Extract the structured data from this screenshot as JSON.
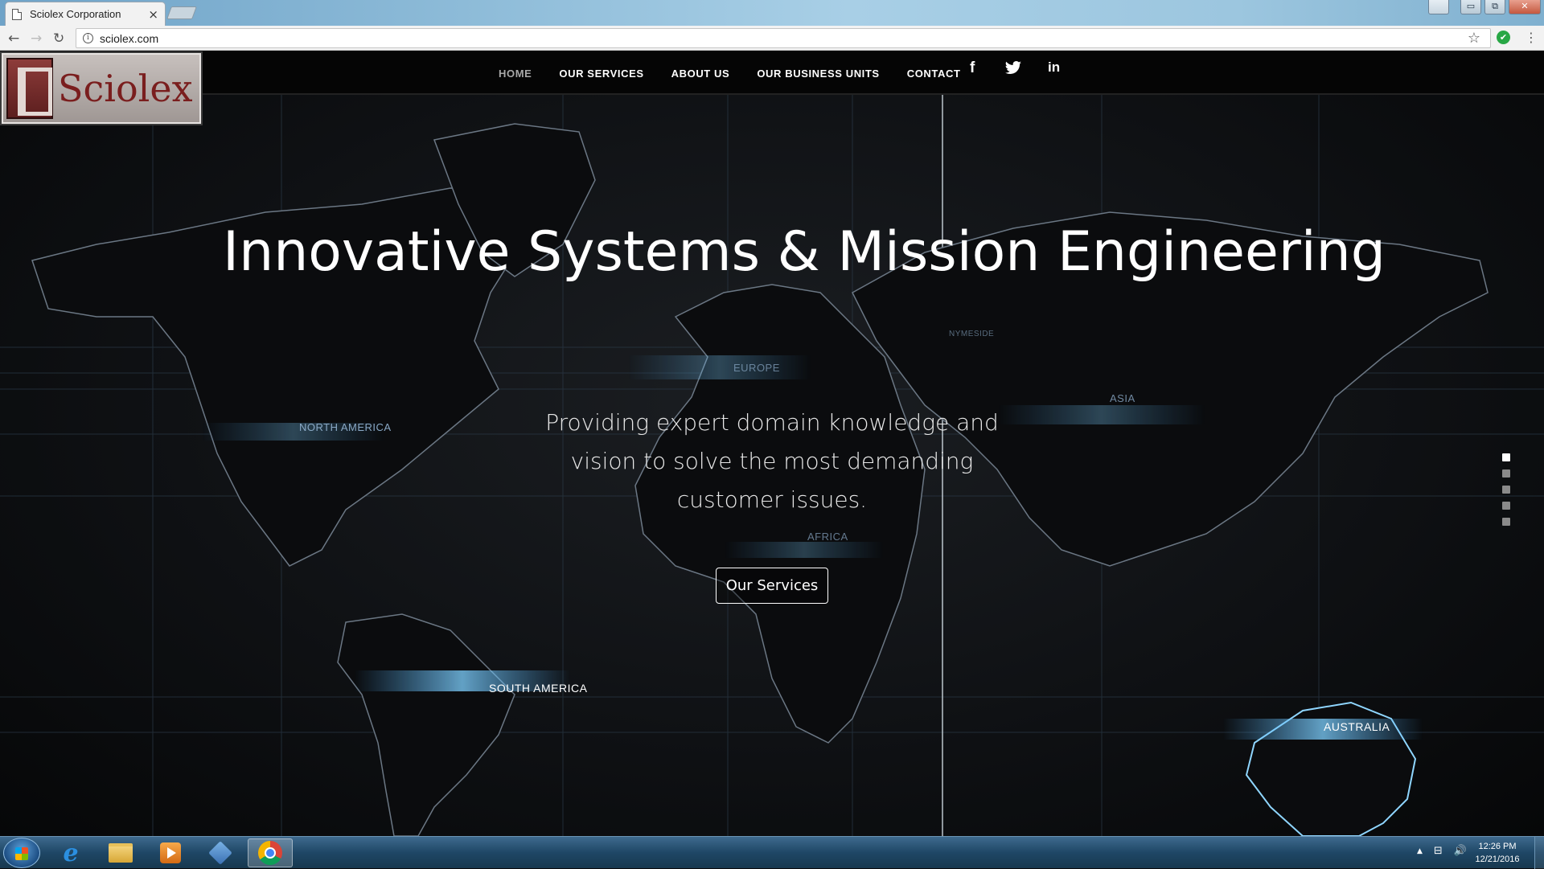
{
  "browser": {
    "tab_title": "Sciolex Corporation",
    "tab_close": "×",
    "url": "sciolex.com",
    "win_min": "▭",
    "win_max": "⧉",
    "win_close": "✕",
    "back": "←",
    "forward": "→",
    "reload": "↻",
    "star": "☆",
    "menu": "⋮",
    "ext": "✔"
  },
  "site": {
    "logo_text": "Sciolex",
    "nav": [
      "HOME",
      "OUR SERVICES",
      "ABOUT US",
      "OUR BUSINESS UNITS",
      "CONTACT"
    ],
    "active_nav": "HOME",
    "social": {
      "facebook": "f",
      "twitter": "🐦",
      "linkedin": "in"
    },
    "hero_title": "Innovative Systems & Mission Engineering",
    "hero_subtitle": "Providing expert domain knowledge and vision to solve the most demanding customer issues.",
    "cta_label": "Our Services",
    "slider_dots": 5,
    "slider_active": 1,
    "regions": [
      "NORTH AMERICA",
      "SOUTH AMERICA",
      "EUROPE",
      "AFRICA",
      "ASIA",
      "AUSTRALIA",
      "NYMESIDE"
    ],
    "accent_color": "#4fb3ff"
  },
  "taskbar": {
    "time": "12:26 PM",
    "date": "12/21/2016",
    "tray_icons": [
      "▲",
      "⊟",
      "🔊"
    ]
  }
}
